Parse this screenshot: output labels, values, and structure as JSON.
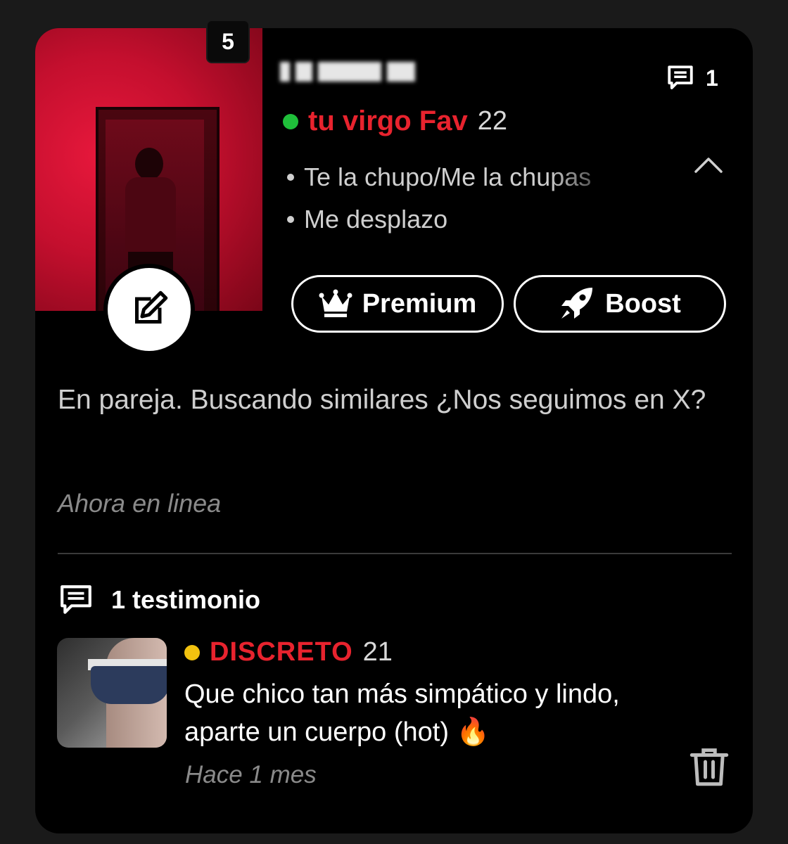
{
  "profile": {
    "photo_count": "5",
    "message_count": "1",
    "nickname": "tu virgo Fav",
    "age": "22",
    "online_dot_color": "#1fbf3a",
    "tags": [
      "Te la chupo/Me la chupas",
      "Me desplazo"
    ],
    "bio": "En pareja. Buscando similares ¿Nos seguimos en X?",
    "status": "Ahora en linea"
  },
  "buttons": {
    "premium_label": "Premium",
    "boost_label": "Boost"
  },
  "testimonials": {
    "header": "1 testimonio",
    "items": [
      {
        "nickname": "DISCRETO",
        "age": "21",
        "dot_color": "#f2c20f",
        "text": "Que chico tan más simpático y lindo, aparte un cuerpo (hot) 🔥",
        "time": "Hace 1 mes"
      }
    ]
  },
  "icons": {
    "edit": "edit-icon",
    "message": "message-icon",
    "chevron": "chevron-up-icon",
    "crown": "crown-icon",
    "rocket": "rocket-icon",
    "comment": "comment-icon",
    "trash": "trash-icon"
  },
  "colors": {
    "accent_red": "#e8232e",
    "background": "#000000"
  }
}
